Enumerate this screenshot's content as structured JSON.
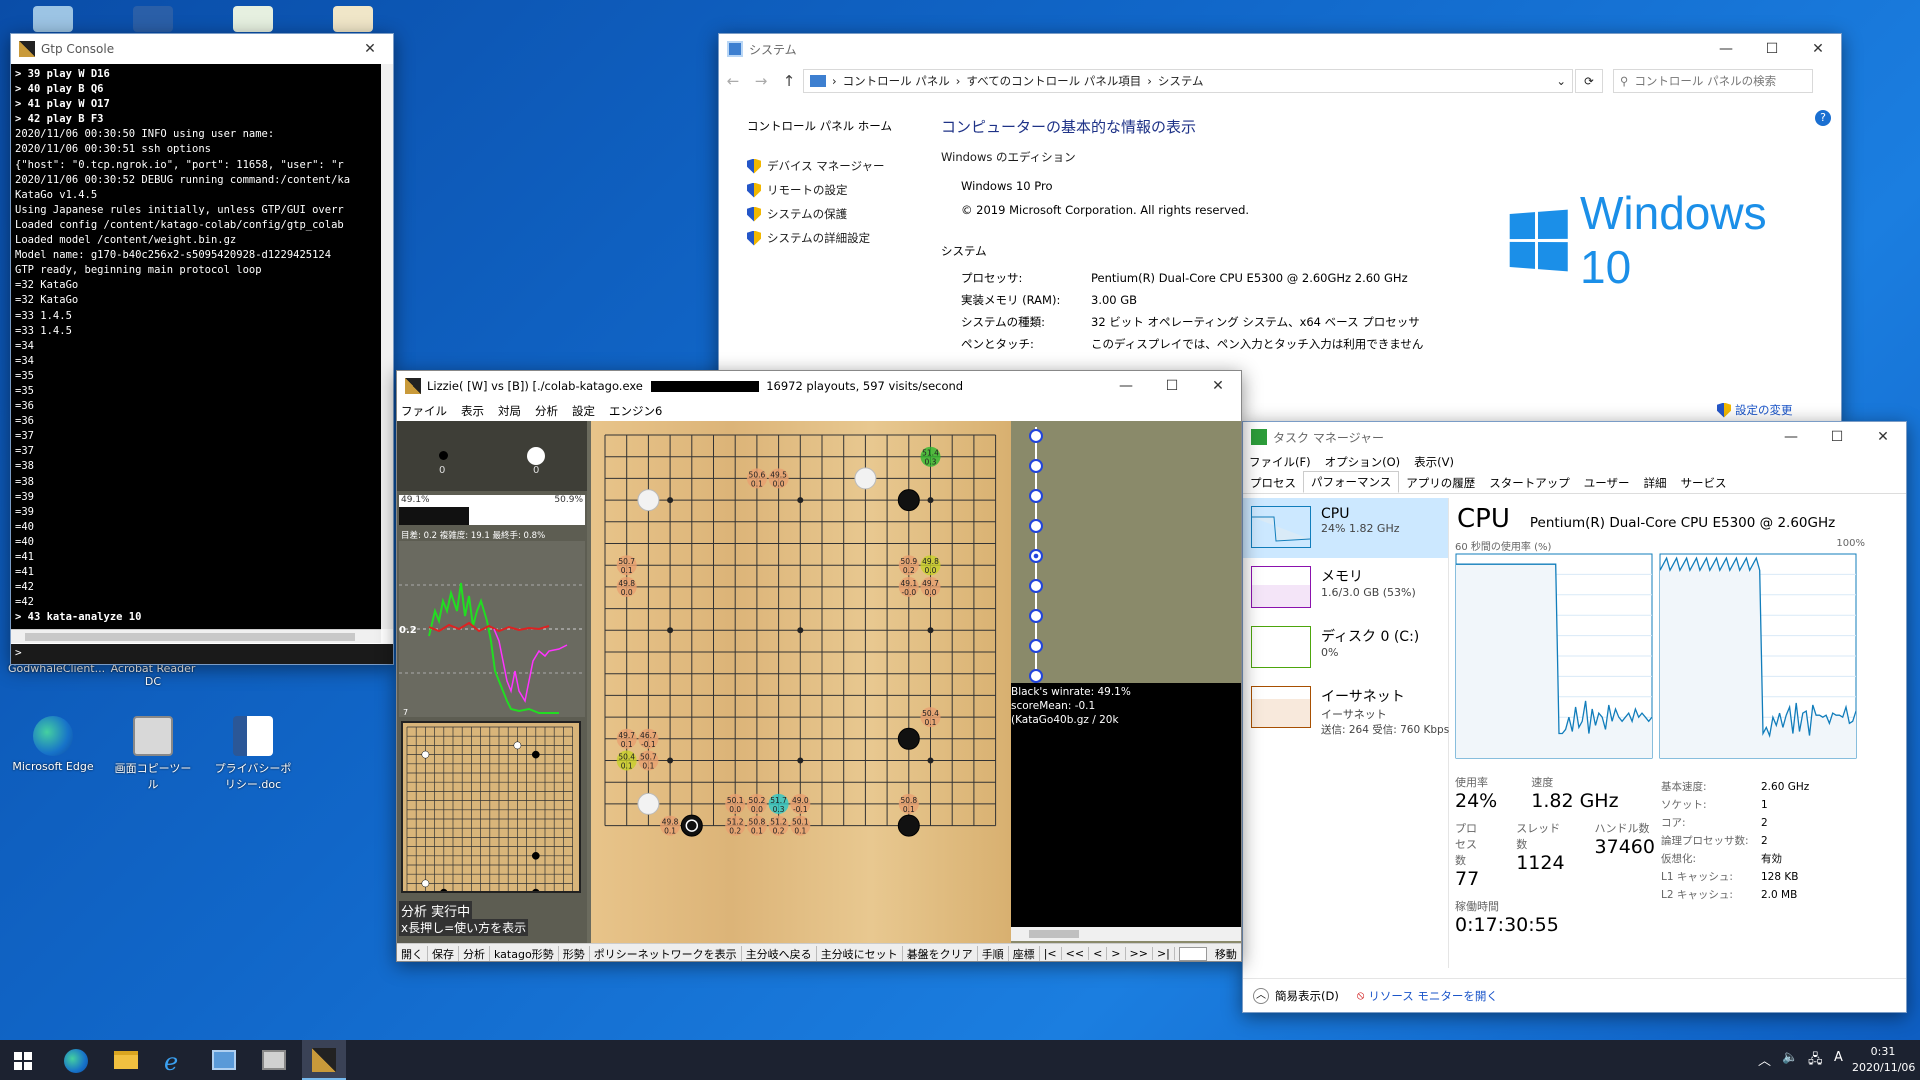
{
  "desktop": {
    "icons": [
      {
        "label": "GodwhaleClient...",
        "icon": "app-icon"
      },
      {
        "label": "Acrobat Reader DC",
        "icon": "pdf-icon"
      },
      {
        "label": "Microsoft Edge",
        "icon": "edge-icon"
      },
      {
        "label": "画面コピーツール",
        "icon": "tool-icon"
      },
      {
        "label": "プライバシーポリシー.doc",
        "icon": "word-icon"
      }
    ]
  },
  "gtp_console": {
    "title": "Gtp Console",
    "lines": [
      "> 39 play W D16",
      "> 40 play B Q6",
      "> 41 play W O17",
      "> 42 play B F3",
      "2020/11/06 00:30:50 INFO using user name:",
      "2020/11/06 00:30:51 ssh options",
      "{\"host\": \"0.tcp.ngrok.io\", \"port\": 11658, \"user\": \"r",
      "2020/11/06 00:30:52 DEBUG running command:/content/ka",
      "KataGo v1.4.5",
      "Using Japanese rules initially, unless GTP/GUI overr",
      "Loaded config /content/katago-colab/config/gtp_colab",
      "Loaded model /content/weight.bin.gz",
      "Model name: g170-b40c256x2-s5095420928-d1229425124",
      "GTP ready, beginning main protocol loop",
      "=32 KataGo",
      "=32 KataGo",
      "=33 1.4.5",
      "=33 1.4.5",
      "=34",
      "=34",
      "=35",
      "=35",
      "=36",
      "=36",
      "=37",
      "=37",
      "=38",
      "=38",
      "=39",
      "=39",
      "=40",
      "=40",
      "=41",
      "=41",
      "=42",
      "=42",
      "> 43 kata-analyze 10"
    ],
    "prompt": ">"
  },
  "control_panel": {
    "title": "システム",
    "breadcrumb": [
      "コントロール パネル",
      "すべてのコントロール パネル項目",
      "システム"
    ],
    "search_placeholder": "コントロール パネルの検索",
    "home_link": "コントロール パネル ホーム",
    "left_links": [
      "デバイス マネージャー",
      "リモートの設定",
      "システムの保護",
      "システムの詳細設定"
    ],
    "heading": "コンピューターの基本的な情報の表示",
    "edition_section": "Windows のエディション",
    "edition": "Windows 10 Pro",
    "copyright": "© 2019 Microsoft Corporation. All rights reserved.",
    "logo_text": "Windows 10",
    "system_section": "システム",
    "rows": [
      {
        "k": "プロセッサ:",
        "v": "Pentium(R) Dual-Core  CPU     E5300  @ 2.60GHz   2.60 GHz"
      },
      {
        "k": "実装メモリ (RAM):",
        "v": "3.00 GB"
      },
      {
        "k": "システムの種類:",
        "v": "32 ビット オペレーティング システム、x64 ベース プロセッサ"
      },
      {
        "k": "ペンとタッチ:",
        "v": "このディスプレイでは、ペン入力とタッチ入力は利用できません"
      }
    ],
    "change_settings": "設定の変更"
  },
  "lizzie": {
    "title_prefix": "Lizzie( [W] vs  [B]) [./colab-katago.exe",
    "title_suffix": "16972 playouts, 597 visits/second",
    "menu": [
      "ファイル",
      "表示",
      "対局",
      "分析",
      "設定",
      "エンジン6"
    ],
    "captures": {
      "black": "0",
      "white": "0"
    },
    "winrate_left": "49.1%",
    "winrate_right": "50.9%",
    "stats_line": "目差: 0.2 複雑度: 19.1 最終手: 0.8%",
    "graph_label_mid": "0.2",
    "graph_label_bottom": "7",
    "status1": "分析 実行中",
    "status2": "x長押し=使い方を表示",
    "info1": "Black's winrate: 49.1%",
    "info2": "scoreMean: -0.1",
    "info3": "(KataGo40b.gz / 20k",
    "buttons": [
      "開く",
      "保存",
      "分析",
      "katago形勢",
      "形勢",
      "ポリシーネットワークを表示",
      "主分岐へ戻る",
      "主分岐にセット",
      "碁盤をクリア",
      "手順",
      "座標",
      "|<",
      "<<",
      "<",
      ">",
      ">>",
      ">|"
    ],
    "move_button": "移動",
    "candidates": [
      {
        "c": 8,
        "r": 3,
        "t1": "50.6",
        "t2": "0.1",
        "col": "#e8a070"
      },
      {
        "c": 9,
        "r": 3,
        "t1": "49.5",
        "t2": "0.0",
        "col": "#e8a070"
      },
      {
        "c": 2,
        "r": 7,
        "t1": "50.7",
        "t2": "0.1",
        "col": "#e8a070"
      },
      {
        "c": 2,
        "r": 8,
        "t1": "49.8",
        "t2": "0.0",
        "col": "#e8a070"
      },
      {
        "c": 15,
        "r": 7,
        "t1": "50.9",
        "t2": "0.2",
        "col": "#e8a070"
      },
      {
        "c": 16,
        "r": 7,
        "t1": "49.8",
        "t2": "0.0",
        "col": "#c7d028"
      },
      {
        "c": 15,
        "r": 8,
        "t1": "49.1",
        "t2": "-0.0",
        "col": "#e8a070"
      },
      {
        "c": 16,
        "r": 8,
        "t1": "49.7",
        "t2": "0.0",
        "col": "#e8a070"
      },
      {
        "c": 16,
        "r": 2,
        "t1": "51.4",
        "t2": "0.3",
        "col": "#2db82d"
      },
      {
        "c": 16,
        "r": 14,
        "t1": "50.4",
        "t2": "0.1",
        "col": "#e8a070"
      },
      {
        "c": 2,
        "r": 15,
        "t1": "49.7",
        "t2": "0.1",
        "col": "#e8a070"
      },
      {
        "c": 3,
        "r": 15,
        "t1": "46.7",
        "t2": "-0.1",
        "col": "#e8a070"
      },
      {
        "c": 2,
        "r": 16,
        "t1": "50.4",
        "t2": "0.1",
        "col": "#c7d028"
      },
      {
        "c": 3,
        "r": 16,
        "t1": "50.7",
        "t2": "0.1",
        "col": "#e8a070"
      },
      {
        "c": 7,
        "r": 18,
        "t1": "50.1",
        "t2": "0.0",
        "col": "#e8a070"
      },
      {
        "c": 8,
        "r": 18,
        "t1": "50.2",
        "t2": "0.0",
        "col": "#e8a070"
      },
      {
        "c": 9,
        "r": 18,
        "t1": "51.7",
        "t2": "0.3",
        "col": "#28c8c8"
      },
      {
        "c": 10,
        "r": 18,
        "t1": "49.0",
        "t2": "-0.1",
        "col": "#e8a070"
      },
      {
        "c": 7,
        "r": 19,
        "t1": "51.2",
        "t2": "0.2",
        "col": "#e8a070"
      },
      {
        "c": 8,
        "r": 19,
        "t1": "50.8",
        "t2": "0.1",
        "col": "#e8a070"
      },
      {
        "c": 9,
        "r": 19,
        "t1": "51.2",
        "t2": "0.2",
        "col": "#e8a070"
      },
      {
        "c": 10,
        "r": 19,
        "t1": "50.1",
        "t2": "0.1",
        "col": "#e8a070"
      },
      {
        "c": 4,
        "r": 19,
        "t1": "49.8",
        "t2": "0.1",
        "col": "#e8a070"
      },
      {
        "c": 15,
        "r": 18,
        "t1": "50.8",
        "t2": "0.1",
        "col": "#e8a070"
      }
    ],
    "stones": [
      {
        "c": 3,
        "r": 4,
        "color": "white"
      },
      {
        "c": 13,
        "r": 3,
        "color": "white"
      },
      {
        "c": 15,
        "r": 4,
        "color": "black"
      },
      {
        "c": 15,
        "r": 15,
        "color": "black"
      },
      {
        "c": 3,
        "r": 18,
        "color": "white"
      },
      {
        "c": 5,
        "r": 19,
        "color": "black",
        "last": true
      },
      {
        "c": 15,
        "r": 19,
        "color": "black"
      }
    ]
  },
  "task_manager": {
    "title": "タスク マネージャー",
    "menu": [
      "ファイル(F)",
      "オプション(O)",
      "表示(V)"
    ],
    "tabs": [
      "プロセス",
      "パフォーマンス",
      "アプリの履歴",
      "スタートアップ",
      "ユーザー",
      "詳細",
      "サービス"
    ],
    "side": [
      {
        "name": "CPU",
        "detail": "24%  1.82 GHz",
        "detail2": ""
      },
      {
        "name": "メモリ",
        "detail": "1.6/3.0 GB (53%)",
        "detail2": ""
      },
      {
        "name": "ディスク 0 (C:)",
        "detail": "0%",
        "detail2": ""
      },
      {
        "name": "イーサネット",
        "detail": "イーサネット",
        "detail2": "送信: 264  受信: 760 Kbps"
      }
    ],
    "cpu_title": "CPU",
    "cpu_model": "Pentium(R) Dual-Core  CPU    E5300  @ 2.60GHz",
    "usage_label": "60 秒間の使用率 (%)",
    "usage_max": "100%",
    "cpu_usage": [
      95,
      95,
      95,
      95,
      95,
      95,
      95,
      95,
      95,
      95,
      95,
      95,
      95,
      95,
      95,
      95,
      95,
      95,
      95,
      95,
      95,
      95,
      95,
      95,
      95,
      95,
      95,
      95,
      95,
      95,
      95,
      12,
      12,
      14,
      20,
      13,
      25,
      15,
      18,
      28,
      12,
      24,
      16,
      22,
      20,
      14,
      26,
      18,
      24,
      20,
      18,
      20,
      22,
      18,
      24,
      20,
      22,
      20,
      18,
      20
    ],
    "stats": {
      "usage_l": "使用率",
      "usage_v": "24%",
      "speed_l": "速度",
      "speed_v": "1.82 GHz",
      "proc_l": "プロセス数",
      "proc_v": "77",
      "thread_l": "スレッド数",
      "thread_v": "1124",
      "handle_l": "ハンドル数",
      "handle_v": "37460",
      "uptime_l": "稼働時間",
      "uptime_v": "0:17:30:55"
    },
    "specs": [
      {
        "k": "基本速度:",
        "v": "2.60 GHz"
      },
      {
        "k": "ソケット:",
        "v": "1"
      },
      {
        "k": "コア:",
        "v": "2"
      },
      {
        "k": "論理プロセッサ数:",
        "v": "2"
      },
      {
        "k": "仮想化:",
        "v": "有効"
      },
      {
        "k": "L1 キャッシュ:",
        "v": "128 KB"
      },
      {
        "k": "L2 キャッシュ:",
        "v": "2.0 MB"
      }
    ],
    "fewer_details": "簡易表示(D)",
    "resource_monitor": "リソース モニターを開く"
  },
  "taskbar": {
    "time": "0:31",
    "date": "2020/11/06",
    "ime": "A"
  }
}
